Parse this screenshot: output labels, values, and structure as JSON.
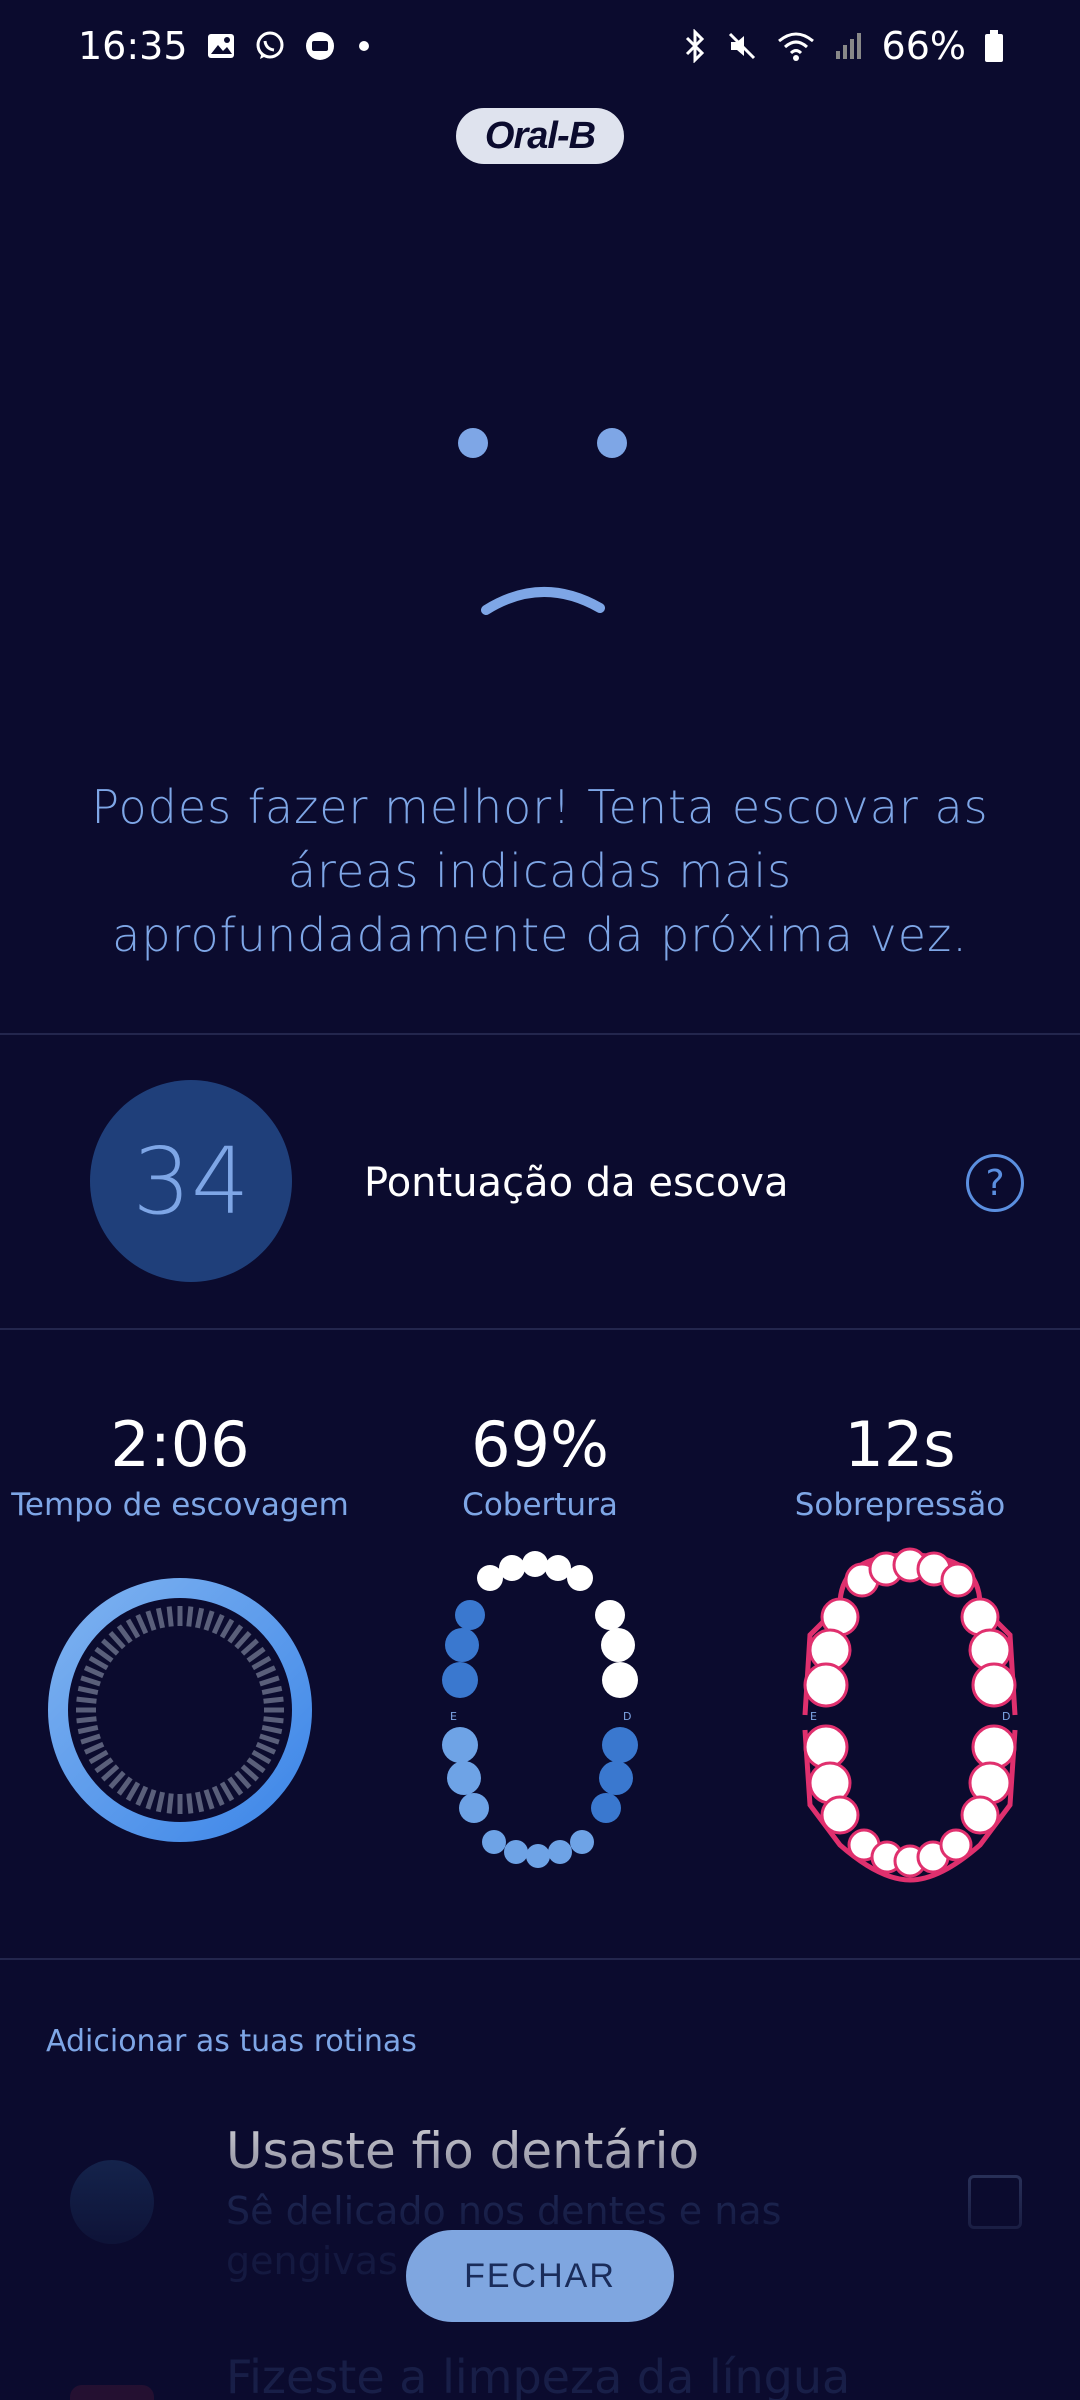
{
  "status_bar": {
    "time": "16:35",
    "battery": "66%",
    "left_icons": [
      "gallery-icon",
      "whatsapp-icon",
      "app-icon",
      "dot-icon"
    ],
    "right_icons": [
      "bluetooth-icon",
      "mute-icon",
      "wifi-icon",
      "signal-icon",
      "battery-icon"
    ]
  },
  "header": {
    "logo": "Oral-B"
  },
  "feedback": {
    "message": "Podes fazer melhor! Tenta escovar as áreas indicadas mais aprofundadamente da próxima vez."
  },
  "score": {
    "value": "34",
    "label": "Pontuação da escova"
  },
  "metrics": {
    "time": {
      "value": "2:06",
      "label": "Tempo de escovagem"
    },
    "coverage": {
      "value": "69%",
      "label": "Cobertura"
    },
    "pressure": {
      "value": "12s",
      "label": "Sobrepressão"
    }
  },
  "mouth_labels": {
    "left": "E",
    "right": "D"
  },
  "routines": {
    "title": "Adicionar as tuas rotinas",
    "items": [
      {
        "title": "Usaste fio dentário",
        "subtitle": "Sê delicado nos dentes e nas gengivas"
      },
      {
        "title": "Fizeste a limpeza da língua"
      }
    ]
  },
  "close_button": {
    "label": "FECHAR"
  },
  "colors": {
    "background": "#0b0b2e",
    "accent": "#7fa6e0",
    "score_circle": "#1f3f7a",
    "overpressure": "#e0306e"
  }
}
